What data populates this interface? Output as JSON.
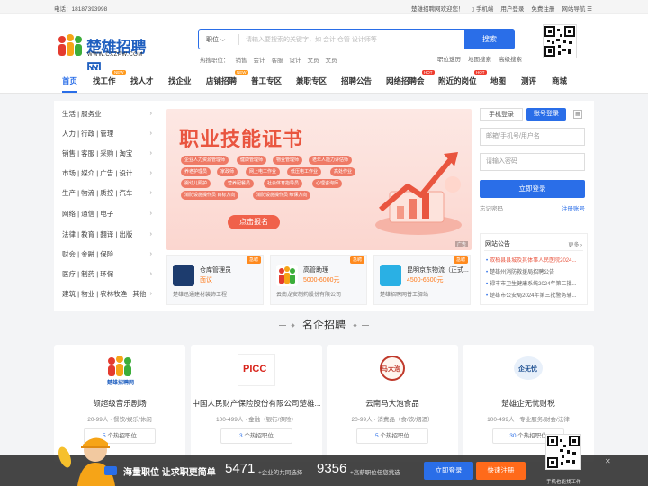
{
  "topbar": {
    "phone": "电话：18187393998",
    "welcome": "楚雄招聘网欢迎您！",
    "mobile": "手机端",
    "login": "用户登录",
    "register": "免费注册",
    "nav": "网站导航"
  },
  "logo": {
    "title": "楚雄招聘网",
    "url_text": "WWW.CXZPW.COM"
  },
  "search": {
    "type": "职位",
    "placeholder": "请输入要搜索的关键字，如 会计 仓管 设计师等",
    "button": "搜索",
    "hot_label": "热搜职位：",
    "hot": [
      "销售",
      "会计",
      "客服",
      "设计",
      "文员",
      "文员"
    ],
    "quick": [
      "职位速历",
      "地图搜索",
      "高级搜索"
    ]
  },
  "nav": {
    "items": [
      "首页",
      "找工作",
      "找人才",
      "找企业",
      "店铺招聘",
      "普工专区",
      "兼职专区",
      "招聘公告",
      "网络招聘会",
      "附近的岗位",
      "地图",
      "测评",
      "商城"
    ],
    "badges": {
      "b1": "NEW",
      "b2": "NEW",
      "b3": "HOT",
      "b4": "HOT"
    }
  },
  "categories": [
    "生活 | 服务业",
    "人力 | 行政 | 管理",
    "销售 | 客服 | 采购 | 淘宝",
    "市场 | 媒介 | 广告 | 设计",
    "生产 | 物流 | 质控 | 汽车",
    "网络 | 通信 | 电子",
    "法律 | 教育 | 翻译 | 出版",
    "财会 | 金融 | 保险",
    "医疗 | 制药 | 环保",
    "建筑 | 物业 | 农林牧渔 | 其他"
  ],
  "banner": {
    "title": "职业技能证书",
    "chips": [
      "企业人力资源管理师",
      "健康管理师",
      "物业管理师",
      "老年人能力评估师",
      "养老护理员",
      "家政师",
      "网上电工作业",
      "低压电工作业",
      "高处作业",
      "婴幼儿照护",
      "营养配餐员",
      "社会体育指导员",
      "心理咨询师",
      "消防设施操作员 目标方向",
      "消防设施操作员 维保方向"
    ],
    "button": "点击报名",
    "ad": "广告"
  },
  "jobs": [
    {
      "tag": "急聘",
      "title": "仓库管理员",
      "salary": "面议",
      "company": "楚雄迅通建材装饰工程"
    },
    {
      "tag": "急聘",
      "title": "高管助理",
      "salary": "5000-6000元",
      "company": "云南龙安制药股份有限公司"
    },
    {
      "tag": "急聘",
      "title": "昆明京东物流（正式...",
      "salary": "4500-6500元",
      "company": "楚雄招聘网普工驿站"
    }
  ],
  "login": {
    "tab_mobile": "手机登录",
    "tab_account": "账号登录",
    "user_placeholder": "邮箱/手机号/用户名",
    "pwd_placeholder": "请输入密码",
    "button": "立即登录",
    "forgot": "忘记密码",
    "register": "注册账号"
  },
  "notice": {
    "title": "网站公告",
    "more": "更多",
    "items": [
      "双柏县县城及其体事人民医院2024...",
      "楚雄州消防救援局招聘公告",
      "禄丰市卫生健康系统2024年第二批...",
      "楚雄市公安局2024年第三批警务辅..."
    ]
  },
  "section_title": "名企招聘",
  "companies": [
    {
      "name": "颉超级音乐剧场",
      "info": "20-99人 · 餐饮/娱乐/休闲",
      "hot": "5",
      "hot_suffix": " 个热招职位",
      "logo": "楚雄招聘网"
    },
    {
      "name": "中国人民财产保险股份有限公司楚雄...",
      "info": "100-499人 · 金融（银行/保险）",
      "hot": "3",
      "hot_suffix": " 个热招职位",
      "logo": "PICC"
    },
    {
      "name": "云南马大泡食品",
      "info": "20-99人 · 消费品（食/饮/烟酒）",
      "hot": "5",
      "hot_suffix": " 个热招职位",
      "logo": "马大泡"
    },
    {
      "name": "楚雄企无忧财税",
      "info": "100-499人 · 专业服务/财会/法律",
      "hot": "30",
      "hot_suffix": " 个热招职位",
      "logo": "企无忧"
    }
  ],
  "bottombar": {
    "slogan": "海量职位 让求职更简单",
    "num1": "5471",
    "desc1": "+企业的共同选择",
    "num2": "9356",
    "desc2": "+高薪职位任您挑选",
    "login": "立即登录",
    "register": "快速注册",
    "qr": "手机也能找工作",
    "close": "✕"
  },
  "colors": {
    "accent": "#2a6ee8",
    "orange": "#ff7a1a",
    "banner": "#e9553f"
  }
}
